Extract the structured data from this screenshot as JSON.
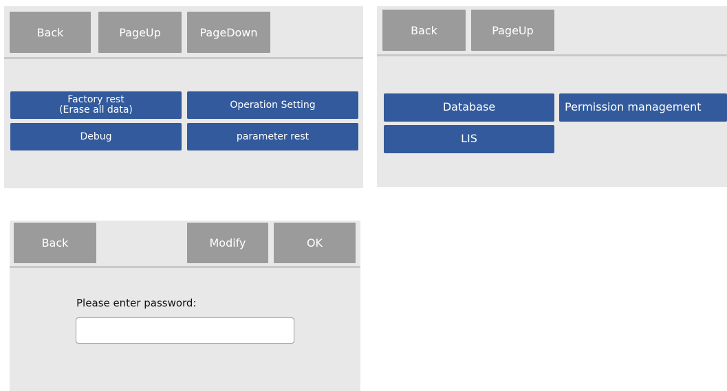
{
  "panel1": {
    "toolbar": {
      "back": "Back",
      "page_up": "PageUp",
      "page_down": "PageDown"
    },
    "buttons": {
      "factory_rest_line1": "Factory rest",
      "factory_rest_line2": "(Erase all data)",
      "operation_setting": "Operation Setting",
      "debug": "Debug",
      "parameter_rest": "parameter rest"
    }
  },
  "panel2": {
    "toolbar": {
      "back": "Back",
      "page_up": "PageUp"
    },
    "buttons": {
      "database": "Database",
      "permission_management": "Permission management",
      "lis": "LIS"
    }
  },
  "panel3": {
    "toolbar": {
      "back": "Back",
      "modify": "Modify",
      "ok": "OK"
    },
    "prompt": "Please enter password:",
    "password_value": ""
  },
  "colors": {
    "panel_bg": "#e8e8e8",
    "toolbar_button": "#9b9b9b",
    "action_button": "#325a9c",
    "separator": "#c9c9c9"
  }
}
